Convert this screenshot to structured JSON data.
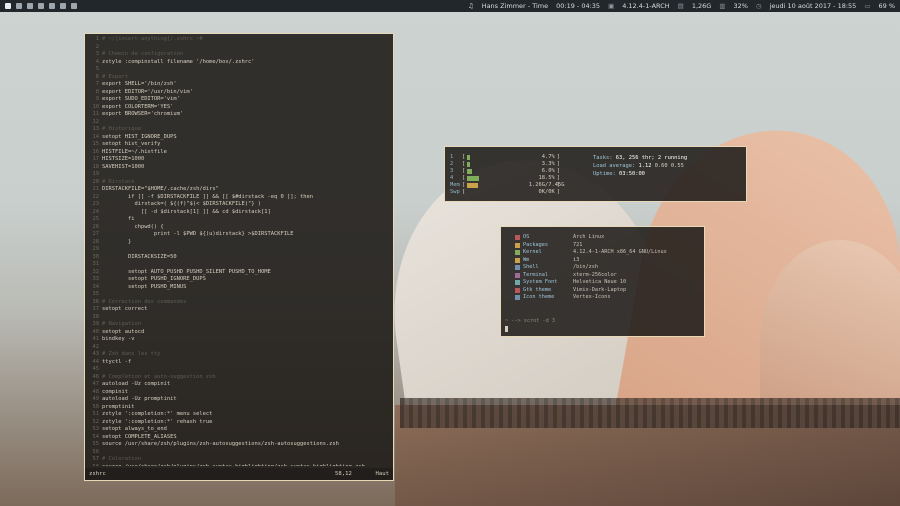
{
  "topbar": {
    "workspaces": [
      {
        "label": "1",
        "active": true
      },
      {
        "label": "2",
        "active": false
      },
      {
        "label": "3",
        "active": false
      },
      {
        "label": "4",
        "active": false
      },
      {
        "label": "5",
        "active": false
      },
      {
        "label": "6",
        "active": false
      },
      {
        "label": "7",
        "active": false
      }
    ],
    "now_playing": "Hans Zimmer - Time",
    "track_time": "00:19 - 04:35",
    "kernel": "4.12.4-1-ARCH",
    "memory": "1,26G",
    "cpu": "32%",
    "datetime": "jeudi 10 août 2017 - 18:55",
    "battery": "69 %"
  },
  "editor": {
    "lines": [
      {
        "n": "1",
        "text": "# ~/[insert-anything]/.zshrc ~#",
        "style": "comment"
      },
      {
        "n": "2",
        "text": "",
        "style": ""
      },
      {
        "n": "3",
        "text": "# Chemin de configuration",
        "style": "comment"
      },
      {
        "n": "4",
        "text": "zstyle :compinstall filename '/home/box/.zshrc'",
        "style": ""
      },
      {
        "n": "5",
        "text": "",
        "style": ""
      },
      {
        "n": "6",
        "text": "# Export",
        "style": "comment"
      },
      {
        "n": "7",
        "text": "export SHELL='/bin/zsh'",
        "style": ""
      },
      {
        "n": "8",
        "text": "export EDITOR='/usr/bin/vim'",
        "style": ""
      },
      {
        "n": "9",
        "text": "export SUDO_EDITOR='vim'",
        "style": ""
      },
      {
        "n": "10",
        "text": "export COLORTERM='YES'",
        "style": ""
      },
      {
        "n": "11",
        "text": "export BROWSER='chromium'",
        "style": ""
      },
      {
        "n": "12",
        "text": "",
        "style": ""
      },
      {
        "n": "13",
        "text": "# Historique",
        "style": "comment"
      },
      {
        "n": "14",
        "text": "setopt HIST_IGNORE_DUPS",
        "style": ""
      },
      {
        "n": "15",
        "text": "setopt hist_verify",
        "style": ""
      },
      {
        "n": "16",
        "text": "HISTFILE=~/.histfile",
        "style": ""
      },
      {
        "n": "17",
        "text": "HISTSIZE=1000",
        "style": ""
      },
      {
        "n": "18",
        "text": "SAVEHIST=1000",
        "style": ""
      },
      {
        "n": "19",
        "text": "",
        "style": ""
      },
      {
        "n": "20",
        "text": "# Dirstack",
        "style": "comment"
      },
      {
        "n": "21",
        "text": "DIRSTACKFILE=\"$HOME/.cache/zsh/dirs\"",
        "style": ""
      },
      {
        "n": "22",
        "text": "        if [[ -f $DIRSTACKFILE ]] && [[ $#dirstack -eq 0 ]]; then",
        "style": ""
      },
      {
        "n": "23",
        "text": "          dirstack=( ${(f)\"$(< $DIRSTACKFILE)\"} )",
        "style": ""
      },
      {
        "n": "24",
        "text": "            [[ -d $dirstack[1] ]] && cd $dirstack[1]",
        "style": ""
      },
      {
        "n": "25",
        "text": "        fi",
        "style": ""
      },
      {
        "n": "26",
        "text": "          chpwd() {",
        "style": ""
      },
      {
        "n": "27",
        "text": "                print -l $PWD ${(u)dirstack} >$DIRSTACKFILE",
        "style": ""
      },
      {
        "n": "28",
        "text": "        }",
        "style": ""
      },
      {
        "n": "29",
        "text": "",
        "style": ""
      },
      {
        "n": "30",
        "text": "        DIRSTACKSIZE=50",
        "style": ""
      },
      {
        "n": "31",
        "text": "",
        "style": ""
      },
      {
        "n": "32",
        "text": "        setopt AUTO_PUSHD PUSHD_SILENT PUSHD_TO_HOME",
        "style": ""
      },
      {
        "n": "33",
        "text": "        setopt PUSHD_IGNORE_DUPS",
        "style": ""
      },
      {
        "n": "34",
        "text": "        setopt PUSHD_MINUS",
        "style": ""
      },
      {
        "n": "35",
        "text": "",
        "style": ""
      },
      {
        "n": "36",
        "text": "# Correction des commandes",
        "style": "comment"
      },
      {
        "n": "37",
        "text": "setopt correct",
        "style": ""
      },
      {
        "n": "38",
        "text": "",
        "style": ""
      },
      {
        "n": "39",
        "text": "# Navigation",
        "style": "comment"
      },
      {
        "n": "40",
        "text": "setopt autocd",
        "style": ""
      },
      {
        "n": "41",
        "text": "bindkey -v",
        "style": ""
      },
      {
        "n": "42",
        "text": "",
        "style": ""
      },
      {
        "n": "43",
        "text": "# Zsh dans les tty",
        "style": "comment"
      },
      {
        "n": "44",
        "text": "ttyctl -f",
        "style": ""
      },
      {
        "n": "45",
        "text": "",
        "style": ""
      },
      {
        "n": "46",
        "text": "# Completion et auto-suggestion zsh",
        "style": "comment"
      },
      {
        "n": "47",
        "text": "autoload -Uz compinit",
        "style": ""
      },
      {
        "n": "48",
        "text": "compinit",
        "style": ""
      },
      {
        "n": "49",
        "text": "autoload -Uz promptinit",
        "style": ""
      },
      {
        "n": "50",
        "text": "promptinit",
        "style": ""
      },
      {
        "n": "51",
        "text": "zstyle ':completion:*' menu select",
        "style": ""
      },
      {
        "n": "52",
        "text": "zstyle ':completion:*' rehash true",
        "style": ""
      },
      {
        "n": "53",
        "text": "setopt always_to_end",
        "style": ""
      },
      {
        "n": "54",
        "text": "setopt COMPLETE_ALIASES",
        "style": ""
      },
      {
        "n": "55",
        "text": "source /usr/share/zsh/plugins/zsh-autosuggestions/zsh-autosuggestions.zsh",
        "style": ""
      },
      {
        "n": "56",
        "text": "",
        "style": ""
      },
      {
        "n": "57",
        "text": "# Coloration",
        "style": "comment"
      },
      {
        "n": "58",
        "text": "source /usr/share/zsh/plugins/zsh-syntax-highlighting/zsh-syntax-highlighting.zsh",
        "style": ""
      },
      {
        "n": "59",
        "text": "autoload -U colors zsh/terminfo",
        "style": ""
      },
      {
        "n": "60",
        "text": "colors",
        "style": ""
      },
      {
        "n": "61",
        "text": "export TERM=xterm-256color",
        "style": ""
      }
    ],
    "status": {
      "filename": "zshrc",
      "position": "58,12",
      "percent": "Haut"
    }
  },
  "htop": {
    "meters": [
      {
        "label": "1",
        "value": "4.7%",
        "fraction": 0.05,
        "kind": "cpu"
      },
      {
        "label": "2",
        "value": "3.3%",
        "fraction": 0.04,
        "kind": "cpu"
      },
      {
        "label": "3",
        "value": "6.0%",
        "fraction": 0.07,
        "kind": "cpu"
      },
      {
        "label": "4",
        "value": "18.5%",
        "fraction": 0.19,
        "kind": "cpu"
      },
      {
        "label": "Mem",
        "value": "1.26G/7.45G",
        "fraction": 0.17,
        "kind": "mem"
      },
      {
        "label": "Swp",
        "value": "0K/0K",
        "fraction": 0.0,
        "kind": "mem"
      }
    ],
    "tasks_label": "Tasks:",
    "tasks_value": "63, 256 thr; 2 running",
    "load_label": "Load average:",
    "load_values": [
      "1.12",
      "0.60",
      "0.55"
    ],
    "uptime_label": "Uptime:",
    "uptime_value": "03:50:00"
  },
  "neofetch": {
    "items": [
      {
        "key": "OS",
        "value": "Arch Linux",
        "color": "#b8585a"
      },
      {
        "key": "Packages",
        "value": "721",
        "color": "#c9a24a"
      },
      {
        "key": "Kernel",
        "value": "4.12.4-1-ARCH x86_64 GNU/Linux",
        "color": "#7fae5a"
      },
      {
        "key": "Wm",
        "value": "i3",
        "color": "#c9a24a"
      },
      {
        "key": "Shell",
        "value": "/bin/zsh",
        "color": "#6f8fb0"
      },
      {
        "key": "Terminal",
        "value": "xterm-256color",
        "color": "#a06a9a"
      },
      {
        "key": "System Font",
        "value": "Helvetica Neue 10",
        "color": "#6fa8a8"
      },
      {
        "key": "Gtk theme",
        "value": "Vimix-Dark-Laptop",
        "color": "#b8585a"
      },
      {
        "key": "Icon theme",
        "value": "Vertex-Icons",
        "color": "#6f8fb0"
      }
    ],
    "prompt": "~ --> scrot -d 3"
  }
}
